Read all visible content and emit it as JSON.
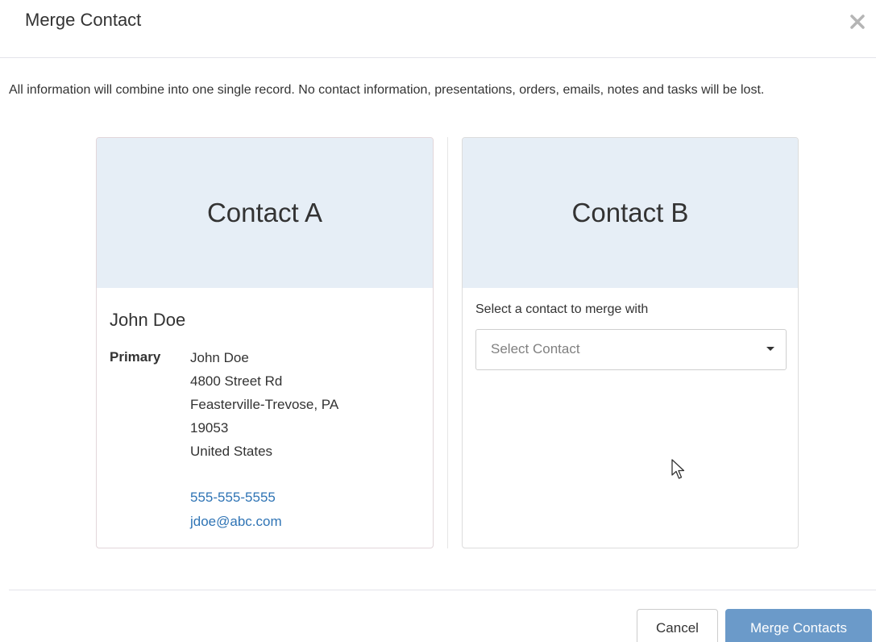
{
  "dialog": {
    "title": "Merge Contact",
    "description": "All information will combine into one single record. No contact information, presentations, orders, emails, notes and tasks will be lost."
  },
  "contact_a": {
    "heading": "Contact A",
    "name": "John Doe",
    "primary_label": "Primary",
    "address_lines": [
      "John Doe",
      "4800 Street Rd",
      "Feasterville-Trevose, PA",
      "19053",
      "United States"
    ],
    "phone": "555-555-5555",
    "email": "jdoe@abc.com"
  },
  "contact_b": {
    "heading": "Contact B",
    "select_label": "Select a contact to merge with",
    "select_placeholder": "Select Contact"
  },
  "footer": {
    "cancel_label": "Cancel",
    "merge_label": "Merge Contacts"
  },
  "icons": {
    "close": "close-icon",
    "caret": "chevron-down-icon",
    "cursor": "mouse-pointer-icon"
  },
  "colors": {
    "card_header_bg": "#e6eef6",
    "link": "#2f74b5",
    "primary_button": "#6b9ac9"
  }
}
